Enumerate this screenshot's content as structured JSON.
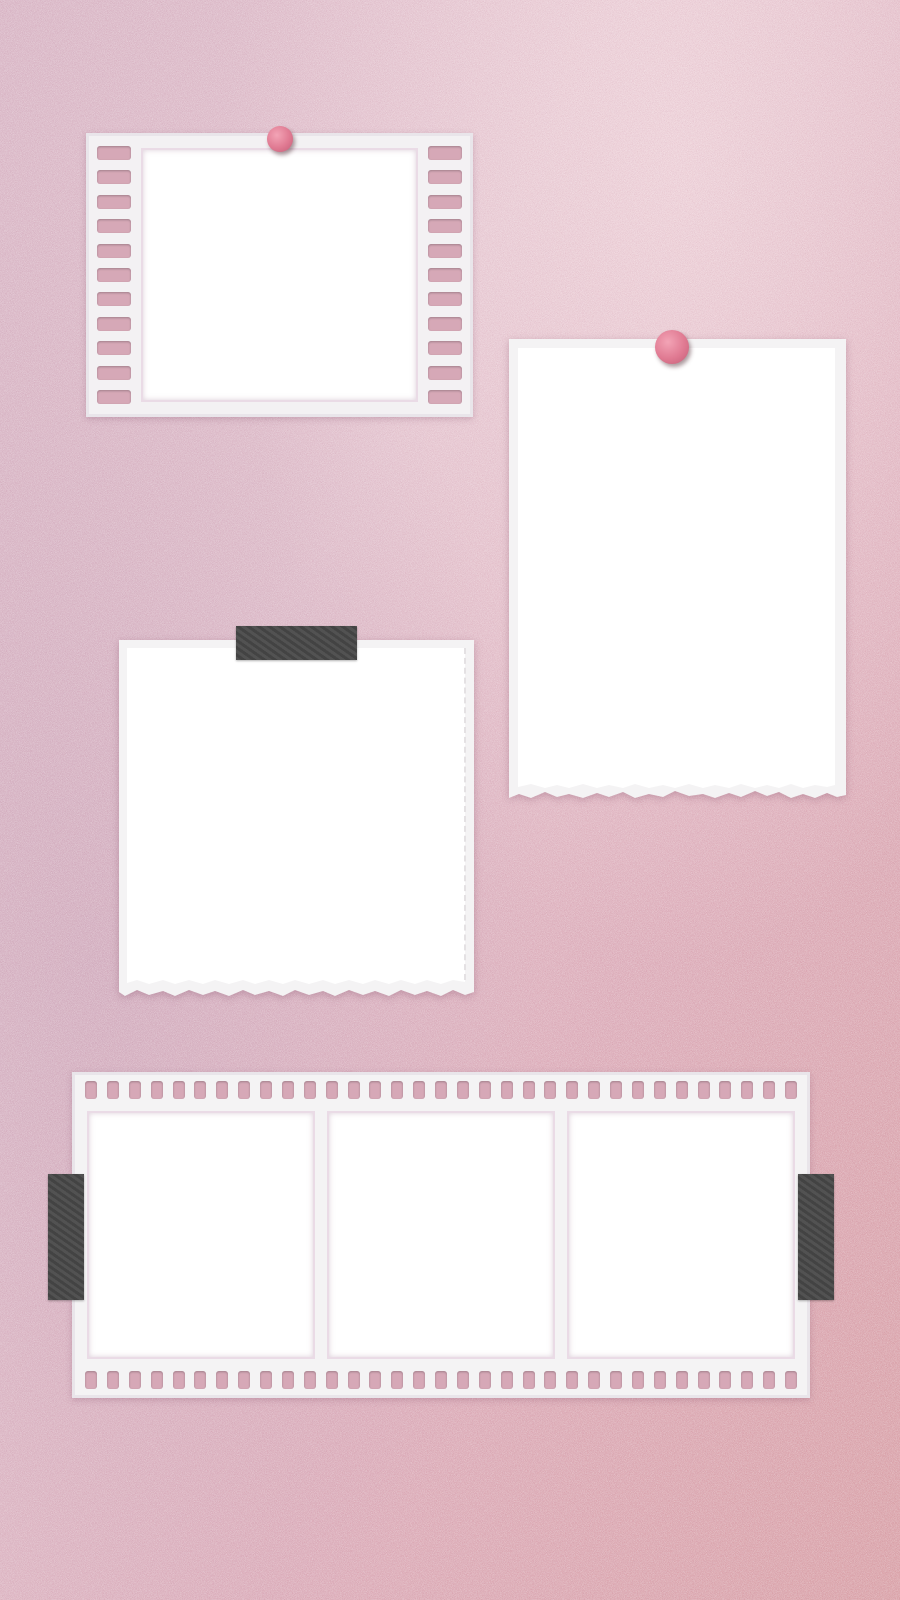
{
  "colors": {
    "background_light": "#e6c4cf",
    "background_rose": "#d7a2ac",
    "background_mauve": "#c9a1b6",
    "pin": "#e07a92",
    "tape": "#494949",
    "film": "#f3f1f3",
    "sprocket_hole": "#d6a8b7"
  },
  "elements": {
    "vertical_film_frame": {
      "icon": "film-strip-frame",
      "sprocket_holes_per_side": 11,
      "photo_slots": 1
    },
    "tall_torn_paper": {
      "icon": "torn-paper-note",
      "fastener": "pushpin",
      "photo_slots": 1
    },
    "taped_torn_paper": {
      "icon": "torn-paper-note",
      "fastener": "tape",
      "photo_slots": 1
    },
    "horizontal_film_strip": {
      "icon": "film-strip",
      "photo_slots": 3,
      "sprocket_holes_per_edge": 33,
      "fastener": "tape"
    }
  }
}
